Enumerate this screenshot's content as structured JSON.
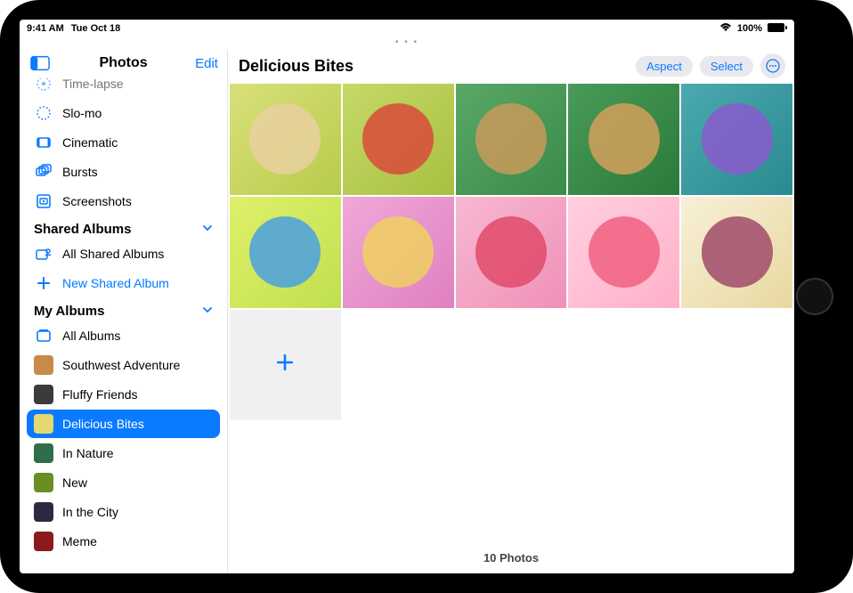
{
  "status": {
    "time": "9:41 AM",
    "date": "Tue Oct 18",
    "wifi_icon": "wifi-icon",
    "battery_percent": "100%",
    "battery_icon": "battery-icon"
  },
  "sidebar": {
    "title": "Photos",
    "edit_label": "Edit",
    "media_types": [
      {
        "icon": "timelapse-icon",
        "label": "Time-lapse",
        "color": "#0a7aff"
      },
      {
        "icon": "slomo-icon",
        "label": "Slo-mo",
        "color": "#0a7aff"
      },
      {
        "icon": "cinematic-icon",
        "label": "Cinematic",
        "color": "#0a7aff"
      },
      {
        "icon": "bursts-icon",
        "label": "Bursts",
        "color": "#0a7aff"
      },
      {
        "icon": "screenshots-icon",
        "label": "Screenshots",
        "color": "#0a7aff"
      }
    ],
    "shared_section": "Shared Albums",
    "shared_items": [
      {
        "icon": "shared-album-icon",
        "label": "All Shared Albums"
      },
      {
        "icon": "plus-icon",
        "label": "New Shared Album",
        "blue": true
      }
    ],
    "my_section": "My Albums",
    "my_items": [
      {
        "icon": "albums-icon",
        "label": "All Albums",
        "thumb_color": null
      },
      {
        "label": "Southwest Adventure",
        "thumb_color": "#c78a4a"
      },
      {
        "label": "Fluffy Friends",
        "thumb_color": "#3b3b3b"
      },
      {
        "label": "Delicious Bites",
        "thumb_color": "#e2d96f",
        "selected": true
      },
      {
        "label": "In Nature",
        "thumb_color": "#2e6e4a"
      },
      {
        "label": "New",
        "thumb_color": "#6b8e23"
      },
      {
        "label": "In the City",
        "thumb_color": "#2b2b40"
      },
      {
        "label": "Meme",
        "thumb_color": "#8b1a1a"
      }
    ]
  },
  "main": {
    "album_title": "Delicious Bites",
    "aspect_label": "Aspect",
    "select_label": "Select",
    "more_icon": "ellipsis-icon",
    "photo_count_label": "10 Photos",
    "add_tile_icon": "plus-icon",
    "photos": [
      {
        "bg": "linear-gradient(135deg,#d9e07a,#b8cc4a)",
        "accent": "#e8d0a0"
      },
      {
        "bg": "linear-gradient(135deg,#c5d968,#a8c040)",
        "accent": "#d94a3a"
      },
      {
        "bg": "linear-gradient(135deg,#5aa866,#3a8a4a)",
        "accent": "#c89a5a"
      },
      {
        "bg": "linear-gradient(135deg,#4a9a5a,#2a7a3a)",
        "accent": "#d4a05a"
      },
      {
        "bg": "linear-gradient(135deg,#4aaab0,#2a8a90)",
        "accent": "#8a5acc"
      },
      {
        "bg": "linear-gradient(135deg,#dff06a,#c0e050)",
        "accent": "#4aa0e0"
      },
      {
        "bg": "linear-gradient(135deg,#f0a8d8,#e080c0)",
        "accent": "#f0d060"
      },
      {
        "bg": "linear-gradient(135deg,#f7b8d2,#f090b8)",
        "accent": "#e04a6a"
      },
      {
        "bg": "linear-gradient(135deg,#ffd0e0,#ffb0c8)",
        "accent": "#f06080"
      },
      {
        "bg": "linear-gradient(135deg,#f8f0d8,#e8d8a0)",
        "accent": "#a04a6a"
      }
    ]
  }
}
